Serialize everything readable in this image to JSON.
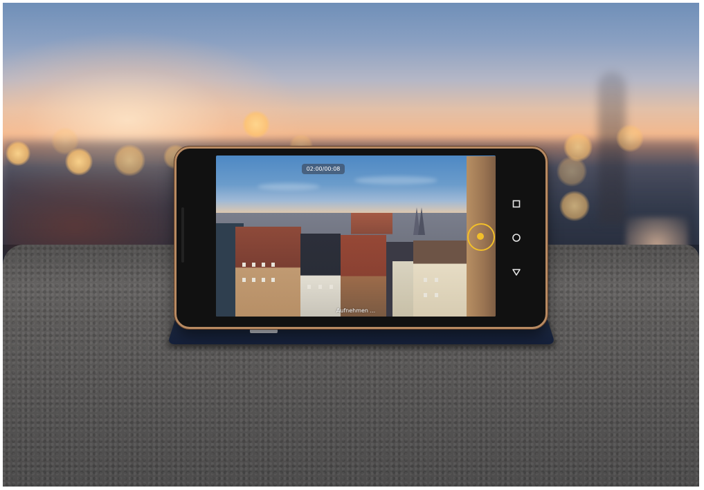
{
  "camera": {
    "timer": "02:00/00:08",
    "status": "Aufnehmen ..."
  },
  "navbar": {
    "icons": [
      "recents-square-icon",
      "home-circle-icon",
      "back-triangle-icon"
    ]
  },
  "colors": {
    "focus_ring": "#f2bf2a",
    "phone_frame": "#b88a62",
    "case": "#1f2c44"
  }
}
